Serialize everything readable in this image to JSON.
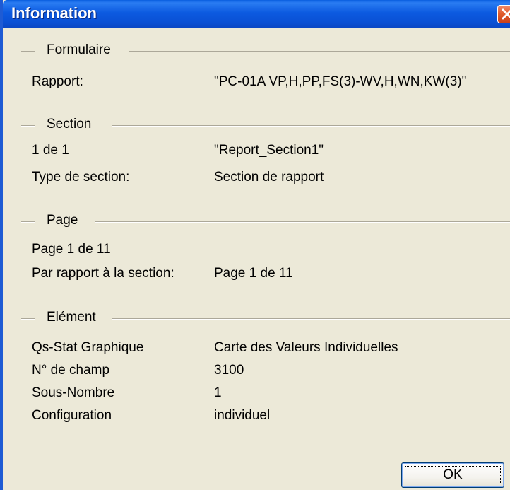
{
  "window": {
    "title": "Information"
  },
  "sections": {
    "formulaire": {
      "title": "Formulaire",
      "rows": [
        {
          "label": "Rapport:",
          "value": "\"PC-01A VP,H,PP,FS(3)-WV,H,WN,KW(3)\""
        }
      ]
    },
    "section": {
      "title": "Section",
      "rows": [
        {
          "label": "1 de 1",
          "value": "\"Report_Section1\""
        },
        {
          "label": "Type de section:",
          "value": "Section de rapport"
        }
      ]
    },
    "page": {
      "title": "Page",
      "rows": [
        {
          "label": "Page 1 de 11",
          "value": ""
        },
        {
          "label": "Par rapport à la section:",
          "value": "Page 1 de 11"
        }
      ]
    },
    "element": {
      "title": "Elément",
      "rows": [
        {
          "label": "Qs-Stat Graphique",
          "value": "Carte des Valeurs Individuelles"
        },
        {
          "label": "N° de champ",
          "value": "3100"
        },
        {
          "label": "Sous-Nombre",
          "value": "1"
        },
        {
          "label": "Configuration",
          "value": "individuel"
        }
      ]
    }
  },
  "buttons": {
    "ok_label": "OK"
  },
  "icons": {
    "close": "close-icon"
  },
  "colors": {
    "titlebar": "#0a5fe0",
    "background": "#ece9d8",
    "close_button": "#e05a2a"
  }
}
